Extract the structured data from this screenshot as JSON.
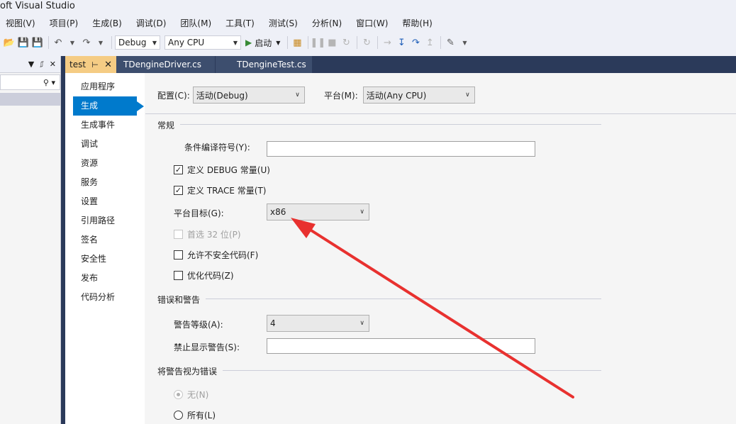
{
  "window": {
    "title": "oft Visual Studio"
  },
  "menu": [
    "视图(V)",
    "项目(P)",
    "生成(B)",
    "调试(D)",
    "团队(M)",
    "工具(T)",
    "测试(S)",
    "分析(N)",
    "窗口(W)",
    "帮助(H)"
  ],
  "toolbar": {
    "config": "Debug",
    "platform": "Any CPU",
    "start_label": "启动"
  },
  "tabs": {
    "active": "test",
    "file1": "TDengineDriver.cs",
    "file2": "TDengineTest.cs"
  },
  "sidenav": [
    "应用程序",
    "生成",
    "生成事件",
    "调试",
    "资源",
    "服务",
    "设置",
    "引用路径",
    "签名",
    "安全性",
    "发布",
    "代码分析"
  ],
  "top": {
    "config_label": "配置(C):",
    "config_value": "活动(Debug)",
    "platform_label": "平台(M):",
    "platform_value": "活动(Any CPU)"
  },
  "general": {
    "title": "常规",
    "symbols_label": "条件编译符号(Y):",
    "symbols_value": "",
    "debug_label": "定义 DEBUG 常量(U)",
    "debug_checked": true,
    "trace_label": "定义 TRACE 常量(T)",
    "trace_checked": true,
    "platform_target_label": "平台目标(G):",
    "platform_target_value": "x86",
    "prefer32_label": "首选 32 位(P)",
    "unsafe_label": "允许不安全代码(F)",
    "optimize_label": "优化代码(Z)"
  },
  "errors": {
    "title": "错误和警告",
    "level_label": "警告等级(A):",
    "level_value": "4",
    "suppress_label": "禁止显示警告(S):",
    "suppress_value": ""
  },
  "treat": {
    "title": "将警告视为错误",
    "none_label": "无(N)",
    "all_label": "所有(L)"
  },
  "colors": {
    "accent": "#007acc",
    "annotation": "#e8312f",
    "tab_active": "#f5cc84"
  }
}
